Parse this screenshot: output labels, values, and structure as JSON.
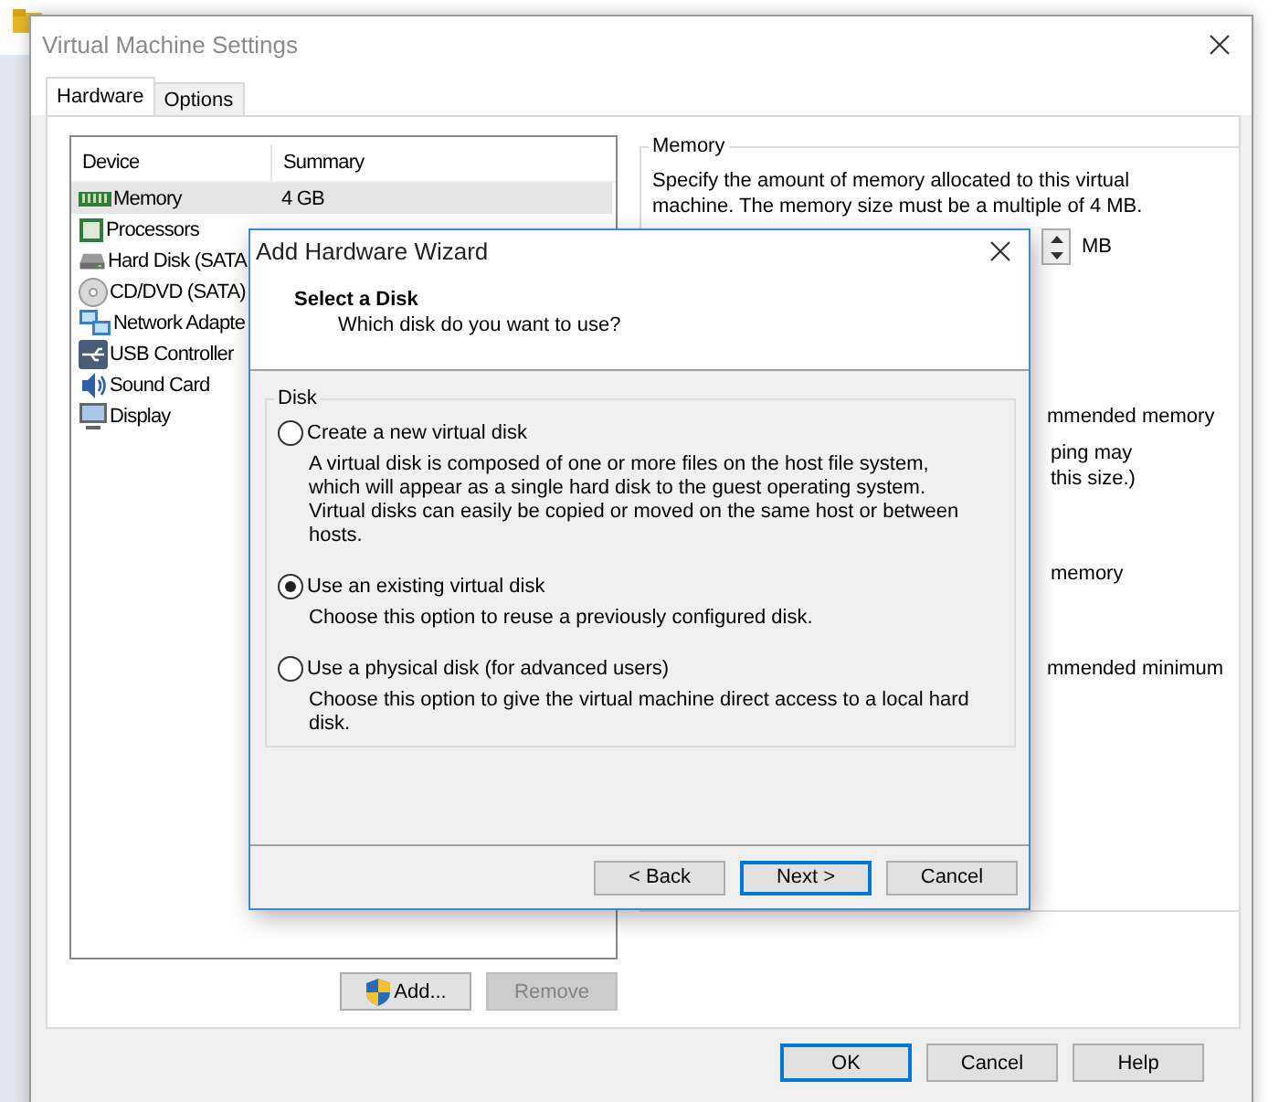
{
  "window": {
    "title": "Virtual Machine Settings"
  },
  "tabs": [
    {
      "label": "Hardware",
      "selected": true
    },
    {
      "label": "Options",
      "selected": false
    }
  ],
  "device_table": {
    "columns": [
      "Device",
      "Summary"
    ],
    "rows": [
      {
        "kind": "memory",
        "device": "Memory",
        "summary": "4 GB",
        "selected": true
      },
      {
        "kind": "processor",
        "device": "Processors",
        "selected": false
      },
      {
        "kind": "harddisk",
        "device": "Hard Disk (SATA",
        "selected": false
      },
      {
        "kind": "cd",
        "device": "CD/DVD (SATA)",
        "selected": false
      },
      {
        "kind": "network",
        "device": "Network Adapte",
        "selected": false
      },
      {
        "kind": "usb",
        "device": "USB Controller",
        "selected": false
      },
      {
        "kind": "sound",
        "device": "Sound Card",
        "selected": false
      },
      {
        "kind": "display",
        "device": "Display",
        "selected": false
      }
    ]
  },
  "memory_panel": {
    "title": "Memory",
    "description": "Specify the amount of memory allocated to this virtual machine. The memory size must be a multiple of 4 MB.",
    "unit": "MB",
    "partial_lines": [
      "mmended memory",
      "ping may",
      "this size.)",
      "memory",
      "mmended minimum"
    ]
  },
  "device_buttons": [
    {
      "label": "Add...",
      "disabled": false,
      "shield": true
    },
    {
      "label": "Remove",
      "disabled": true,
      "shield": false
    }
  ],
  "dialog_buttons": [
    {
      "label": "OK",
      "default": true
    },
    {
      "label": "Cancel",
      "default": false
    },
    {
      "label": "Help",
      "default": false
    }
  ],
  "wizard": {
    "title": "Add Hardware Wizard",
    "heading": "Select a Disk",
    "subheading": "Which disk do you want to use?",
    "group": "Disk",
    "options": [
      {
        "label": "Create a new virtual disk",
        "description": "A virtual disk is composed of one or more files on the host file system, which will appear as a single hard disk to the guest operating system. Virtual disks can easily be copied or moved on the same host or between hosts.",
        "selected": false
      },
      {
        "label": "Use an existing virtual disk",
        "description": "Choose this option to reuse a previously configured disk.",
        "selected": true
      },
      {
        "label": "Use a physical disk (for advanced users)",
        "description": "Choose this option to give the virtual machine direct access to a local hard disk.",
        "selected": false
      }
    ],
    "buttons": [
      {
        "label": "< Back",
        "default": false
      },
      {
        "label": "Next >",
        "default": true
      },
      {
        "label": "Cancel",
        "default": false
      }
    ]
  }
}
